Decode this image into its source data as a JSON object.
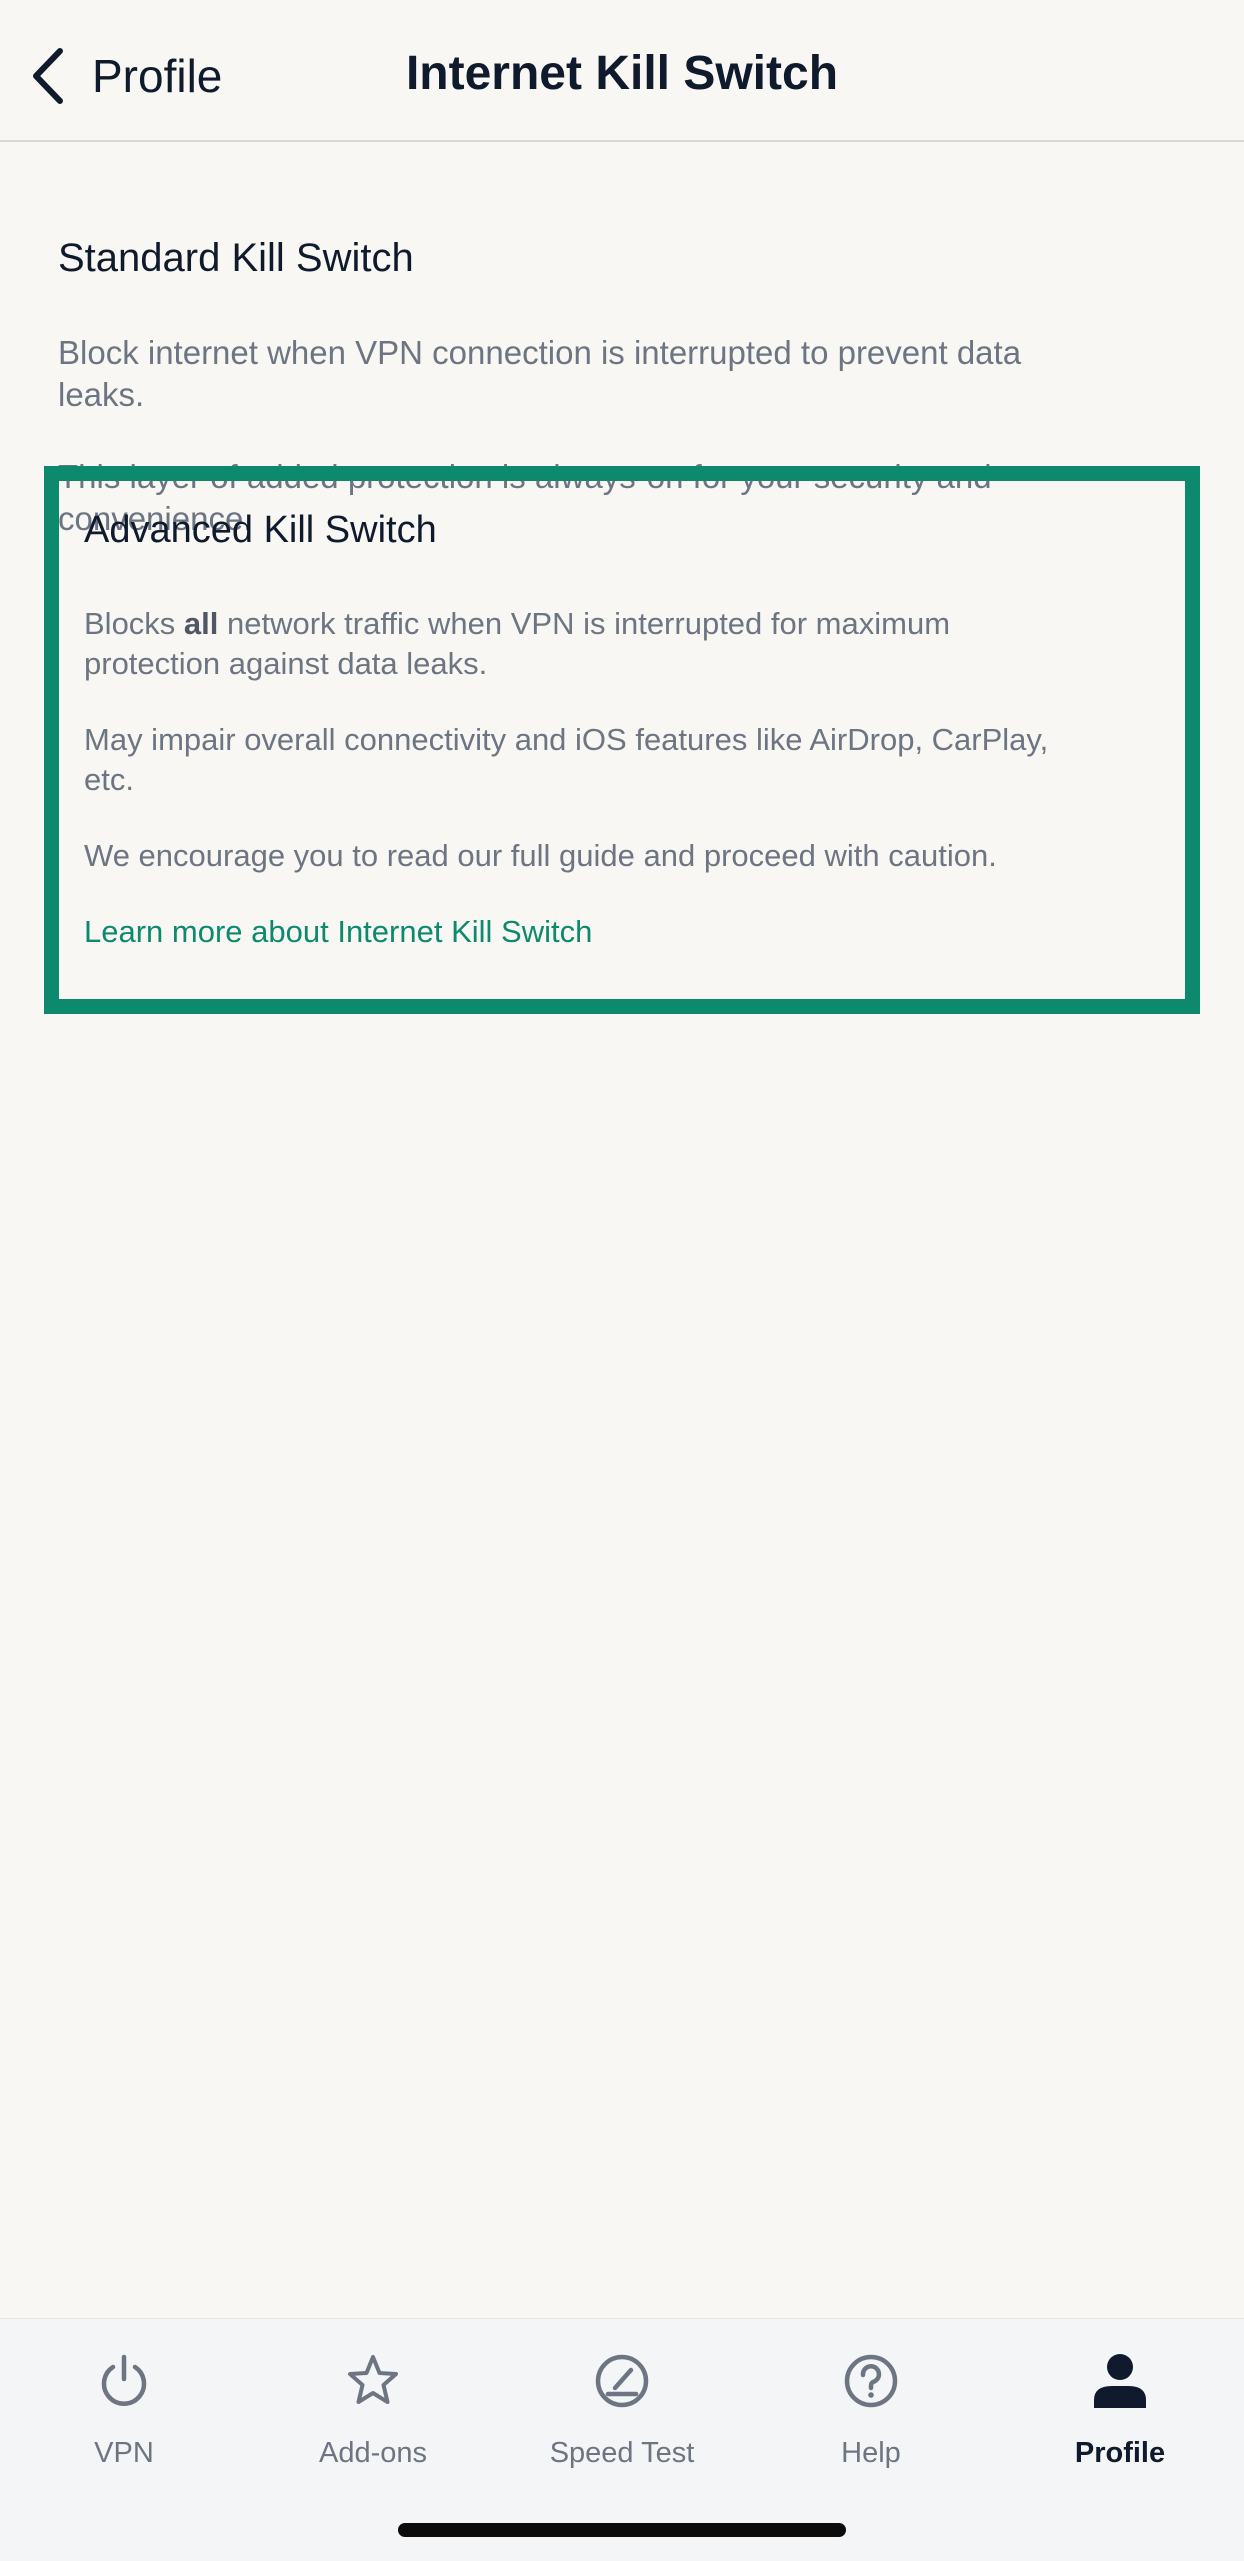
{
  "header": {
    "back_label": "Profile",
    "title": "Internet Kill Switch"
  },
  "standard": {
    "title": "Standard Kill Switch",
    "desc1": "Block internet when VPN connection is interrupted to prevent data leaks.",
    "desc2": "This layer of added protection is always-on for your security and convenience."
  },
  "advanced": {
    "title": "Advanced Kill Switch",
    "desc1_prefix": "Blocks ",
    "desc1_bold": "all",
    "desc1_suffix": " network traffic when VPN is interrupted for maximum protection against data leaks.",
    "desc2": "May impair overall connectivity and iOS features like AirDrop, CarPlay, etc.",
    "desc3": "We encourage you to read our full guide and proceed with caution.",
    "link": "Learn more about Internet Kill Switch"
  },
  "tabbar": {
    "tabs": [
      {
        "label": "VPN",
        "icon": "power-icon"
      },
      {
        "label": "Add-ons",
        "icon": "star-icon"
      },
      {
        "label": "Speed Test",
        "icon": "speedometer-icon"
      },
      {
        "label": "Help",
        "icon": "help-icon"
      },
      {
        "label": "Profile",
        "icon": "person-icon",
        "active": true
      }
    ]
  },
  "colors": {
    "accent": "#0d8a6e",
    "text_primary": "#0f1b2d",
    "text_secondary": "#6d7582",
    "background": "#f8f7f3"
  }
}
